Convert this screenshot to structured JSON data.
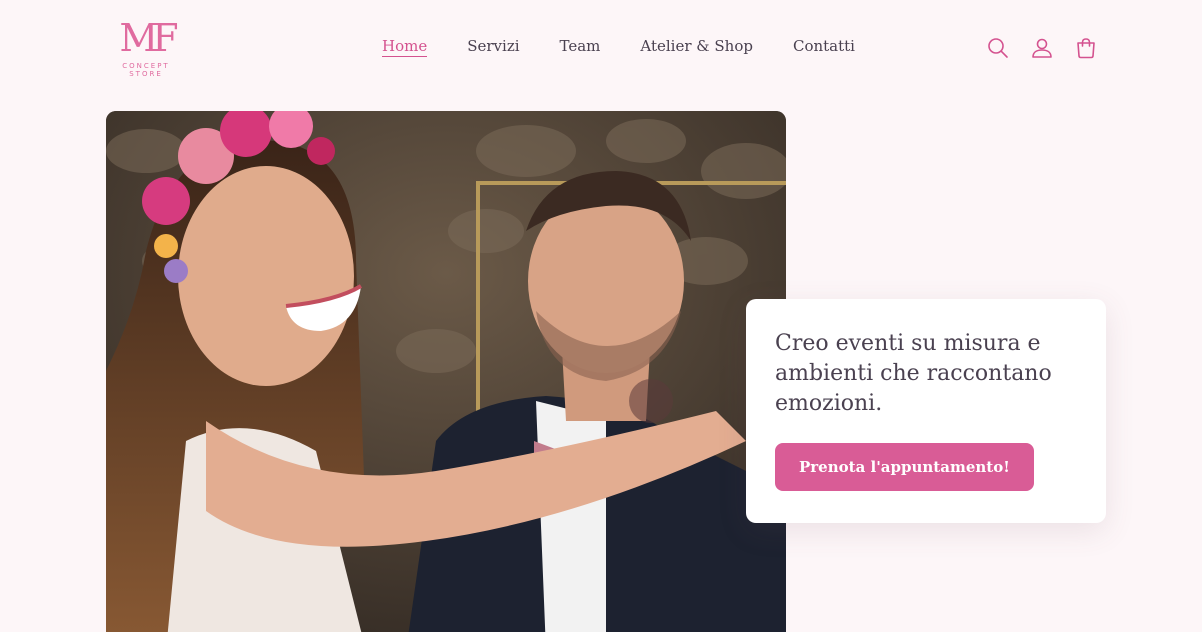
{
  "logo": {
    "mark": "MF",
    "subtitle": "CONCEPT STORE"
  },
  "nav": {
    "items": [
      {
        "label": "Home",
        "active": true
      },
      {
        "label": "Servizi"
      },
      {
        "label": "Team"
      },
      {
        "label": "Atelier & Shop"
      },
      {
        "label": "Contatti"
      }
    ]
  },
  "header_icons": [
    "search-icon",
    "account-icon",
    "cart-icon"
  ],
  "hero": {
    "image_subject": "bride-and-groom-photo",
    "card": {
      "title": "Creo eventi su misura e ambienti che raccontano emozioni.",
      "button_label": "Prenota l'appuntamento!"
    }
  },
  "colors": {
    "accent": "#d95c96",
    "background": "#fdf6f8",
    "text": "#4a4150"
  }
}
